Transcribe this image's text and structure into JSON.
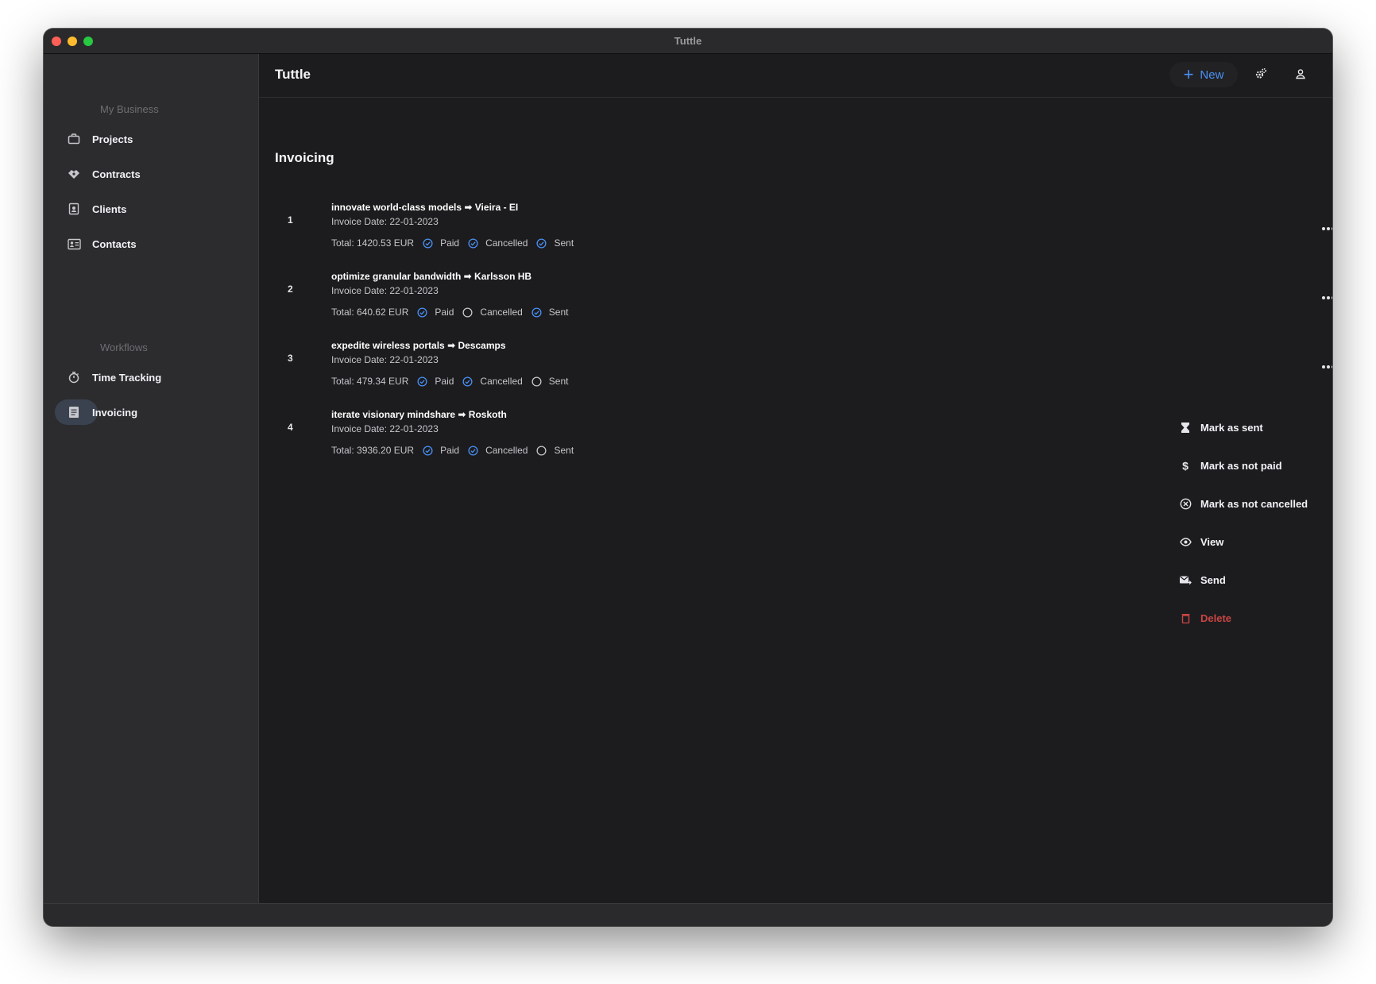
{
  "window": {
    "title": "Tuttle"
  },
  "sidebar": {
    "sections": [
      {
        "title": "My Business",
        "items": [
          {
            "label": "Projects",
            "icon": "briefcase-icon"
          },
          {
            "label": "Contracts",
            "icon": "handshake-icon"
          },
          {
            "label": "Clients",
            "icon": "client-badge-icon"
          },
          {
            "label": "Contacts",
            "icon": "contact-card-icon"
          }
        ]
      },
      {
        "title": "Workflows",
        "items": [
          {
            "label": "Time Tracking",
            "icon": "stopwatch-icon"
          },
          {
            "label": "Invoicing",
            "icon": "invoice-icon",
            "active": true
          }
        ]
      }
    ]
  },
  "appbar": {
    "title": "Tuttle",
    "new_label": "New",
    "icons": [
      "settings-icon",
      "profile-icon",
      "help-icon"
    ]
  },
  "page": {
    "title": "Invoicing"
  },
  "invoices": [
    {
      "number": "1",
      "title": "innovate world-class models ➡ Vieira - EI",
      "date": "Invoice Date: 22-01-2023",
      "total": "Total: 1420.53 EUR",
      "statuses": [
        {
          "label": "Paid",
          "checked": true
        },
        {
          "label": "Cancelled",
          "checked": true
        },
        {
          "label": "Sent",
          "checked": true
        }
      ],
      "has_menu_button": true
    },
    {
      "number": "2",
      "title": "optimize granular bandwidth ➡ Karlsson HB",
      "date": "Invoice Date: 22-01-2023",
      "total": "Total: 640.62 EUR",
      "statuses": [
        {
          "label": "Paid",
          "checked": true
        },
        {
          "label": "Cancelled",
          "checked": false
        },
        {
          "label": "Sent",
          "checked": true
        }
      ],
      "has_menu_button": true
    },
    {
      "number": "3",
      "title": "expedite wireless portals ➡ Descamps",
      "date": "Invoice Date: 22-01-2023",
      "total": "Total: 479.34 EUR",
      "statuses": [
        {
          "label": "Paid",
          "checked": true
        },
        {
          "label": "Cancelled",
          "checked": true
        },
        {
          "label": "Sent",
          "checked": false
        }
      ],
      "has_menu_button": true
    },
    {
      "number": "4",
      "title": "iterate visionary mindshare ➡ Roskoth",
      "date": "Invoice Date: 22-01-2023",
      "total": "Total: 3936.20 EUR",
      "statuses": [
        {
          "label": "Paid",
          "checked": true
        },
        {
          "label": "Cancelled",
          "checked": true
        },
        {
          "label": "Sent",
          "checked": false
        }
      ],
      "has_menu_button": false
    }
  ],
  "context_menu": {
    "items": [
      {
        "label": "Mark as sent",
        "icon": "hourglass-icon"
      },
      {
        "label": "Mark as not paid",
        "icon": "dollar-icon"
      },
      {
        "label": "Mark as not cancelled",
        "icon": "x-circle-icon"
      },
      {
        "label": "View",
        "icon": "eye-icon"
      },
      {
        "label": "Send",
        "icon": "send-mail-icon"
      },
      {
        "label": "Delete",
        "icon": "trash-icon",
        "danger": true
      }
    ]
  },
  "colors": {
    "accent": "#4a90f5",
    "danger": "#c94545",
    "background": "#1c1c1e",
    "sidebar": "#2c2c2e"
  }
}
